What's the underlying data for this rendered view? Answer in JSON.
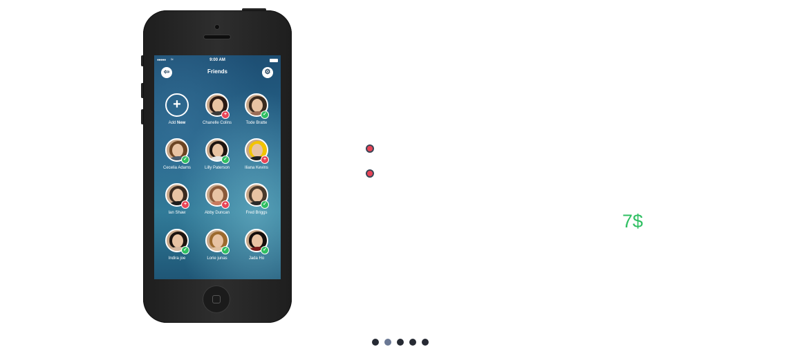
{
  "status_bar": {
    "signal": "●●●●●",
    "wifi": "≈",
    "time": "9:00 AM"
  },
  "nav": {
    "title": "Friends",
    "back_icon": "⇦",
    "settings_icon": "⚙"
  },
  "add_new": {
    "prefix": "Add ",
    "bold": "New",
    "icon": "+"
  },
  "friends": [
    {
      "name": "Chanelle Colins",
      "status": "plus",
      "badge": "+",
      "hair": "#2a1a14",
      "shirt": "#3b3b3b"
    },
    {
      "name": "Tode Bratte",
      "status": "ok",
      "badge": "✓",
      "hair": "#3a2a1e",
      "shirt": "#9b6d56"
    },
    {
      "name": "Cecelia Adams",
      "status": "ok",
      "badge": "✓",
      "hair": "#6b4423",
      "shirt": "#4a5c6e"
    },
    {
      "name": "Lilly Paterson",
      "status": "ok",
      "badge": "✓",
      "hair": "#1d1410",
      "shirt": "#e6e6e6"
    },
    {
      "name": "Iliana Kevins",
      "status": "plus",
      "badge": "+",
      "hair": "#f2c400",
      "shirt": "#222222"
    },
    {
      "name": "Ian Shaw",
      "status": "plus",
      "badge": "+",
      "hair": "#3b2b20",
      "shirt": "#1e1e1e"
    },
    {
      "name": "Abby Duncan",
      "status": "plus",
      "badge": "+",
      "hair": "#8a5a3a",
      "shirt": "#c77a5d"
    },
    {
      "name": "Fred Briggs",
      "status": "ok",
      "badge": "✓",
      "hair": "#4a3a2c",
      "shirt": "#2a2a2a"
    },
    {
      "name": "Indira joe",
      "status": "ok",
      "badge": "✓",
      "hair": "#1c1410",
      "shirt": "#d7b9a0"
    },
    {
      "name": "Lorie junas",
      "status": "ok",
      "badge": "✓",
      "hair": "#9c6a2e",
      "shirt": "#e0c0a0"
    },
    {
      "name": "Jada Ho",
      "status": "ok",
      "badge": "✓",
      "hair": "#140e0c",
      "shirt": "#7a1d1d"
    }
  ],
  "price": "7$",
  "pagination": {
    "count": 5,
    "active_index": 1
  },
  "colors": {
    "accent_green": "#2fbf62",
    "accent_red": "#e84456"
  }
}
